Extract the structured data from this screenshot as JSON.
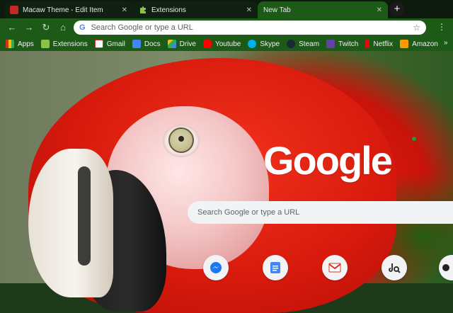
{
  "tabs": [
    {
      "label": "Macaw Theme - Edit Item",
      "icon": "macaw-favicon",
      "close": "✕"
    },
    {
      "label": "Extensions",
      "icon": "puzzle-icon",
      "close": "✕"
    },
    {
      "label": "New Tab",
      "icon": "",
      "close": "✕"
    }
  ],
  "newtab_label": "+",
  "toolbar": {
    "back": "←",
    "forward": "→",
    "reload": "↻",
    "home": "⌂",
    "omnibox_icon": "G",
    "omnibox_placeholder": "Search Google or type a URL",
    "star": "☆",
    "menu": "⋮"
  },
  "bookmarks": [
    {
      "label": "Apps",
      "icon": "apps-grid-icon",
      "color": "#d93025"
    },
    {
      "label": "Extensions",
      "icon": "puzzle-icon",
      "color": "#8bc34a"
    },
    {
      "label": "Gmail",
      "icon": "gmail-icon",
      "color": "#d93025"
    },
    {
      "label": "Docs",
      "icon": "docs-icon",
      "color": "#4285f4"
    },
    {
      "label": "Drive",
      "icon": "drive-icon",
      "color": "#fbbc04"
    },
    {
      "label": "Youtube",
      "icon": "youtube-icon",
      "color": "#ff0000"
    },
    {
      "label": "Skype",
      "icon": "skype-icon",
      "color": "#00aff0"
    },
    {
      "label": "Steam",
      "icon": "steam-icon",
      "color": "#1b2838"
    },
    {
      "label": "Twitch",
      "icon": "twitch-icon",
      "color": "#6441a5"
    },
    {
      "label": "Netflix",
      "icon": "netflix-icon",
      "color": "#e50914"
    },
    {
      "label": "Amazon",
      "icon": "amazon-icon",
      "color": "#ff9900"
    }
  ],
  "bookmarks_more": "»",
  "ntp": {
    "logo_text": "Google",
    "search_placeholder": "Search Google or type a URL"
  },
  "shortcuts": [
    {
      "name": "messenger",
      "icon": "messenger-icon",
      "color": "#1877f2"
    },
    {
      "name": "docs",
      "icon": "docs-icon",
      "color": "#4285f4"
    },
    {
      "name": "gmail",
      "icon": "gmail-icon",
      "color": "#d93025"
    },
    {
      "name": "music",
      "icon": "music-search-icon",
      "color": "#333333"
    },
    {
      "name": "github",
      "icon": "github-icon",
      "color": "#222222"
    }
  ]
}
